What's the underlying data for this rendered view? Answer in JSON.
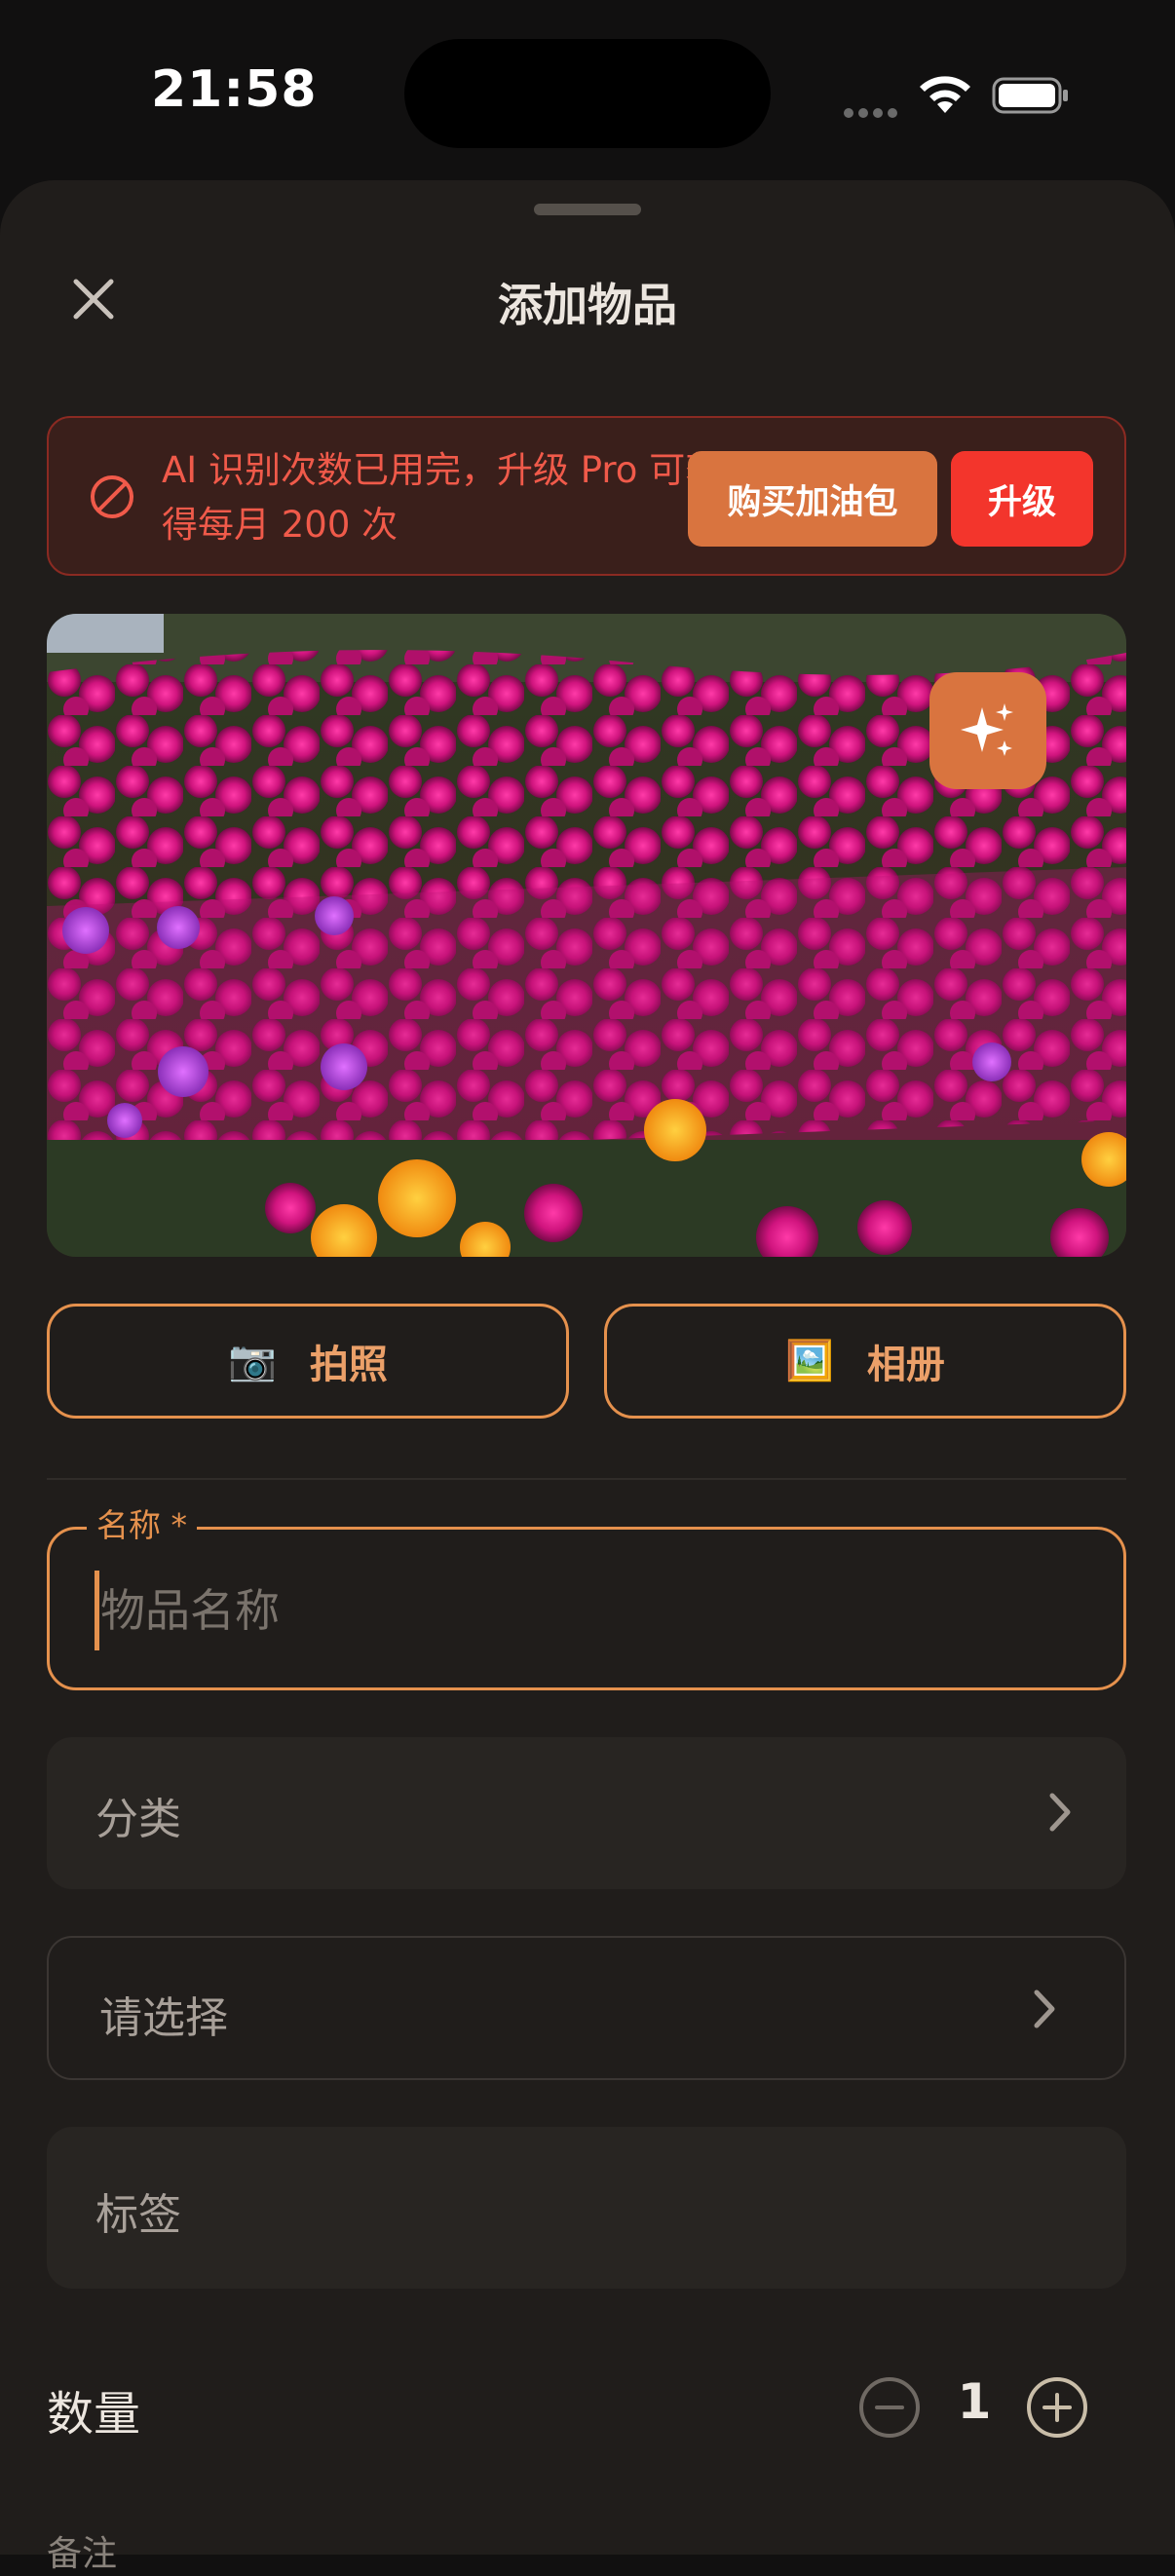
{
  "status_bar": {
    "time": "21:58",
    "icons": [
      "signal-icon",
      "wifi-icon",
      "battery-icon"
    ]
  },
  "sheet": {
    "title": "添加物品",
    "close_icon": "close-icon"
  },
  "banner": {
    "icon": "prohibited-icon",
    "message": "AI 识别次数已用完，升级 Pro 可获得每月 200 次",
    "buy_label": "购买加油包",
    "upgrade_label": "升级"
  },
  "photo": {
    "ai_icon": "sparkles-icon"
  },
  "source_buttons": {
    "camera": {
      "icon": "📷",
      "label": "拍照"
    },
    "album": {
      "icon": "🖼️",
      "label": "相册"
    }
  },
  "form": {
    "name": {
      "label": "名称 *",
      "value": "",
      "placeholder": "物品名称"
    },
    "category": {
      "label": "分类"
    },
    "select": {
      "label": "请选择"
    },
    "tags": {
      "label": "标签"
    },
    "quantity": {
      "label": "数量",
      "value": "1"
    },
    "notes": {
      "label": "备注"
    }
  },
  "colors": {
    "accent": "#e5914d",
    "danger": "#f3352c",
    "background": "#201d1b"
  }
}
